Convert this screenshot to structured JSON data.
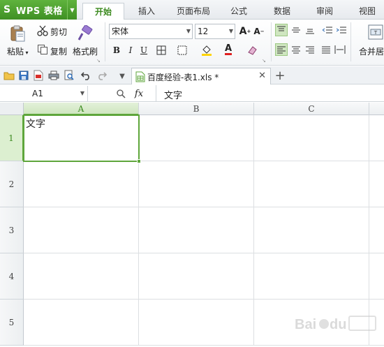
{
  "app": {
    "name": "WPS 表格"
  },
  "menu": {
    "tabs": [
      "开始",
      "插入",
      "页面布局",
      "公式",
      "数据",
      "审阅",
      "视图"
    ],
    "active": "开始"
  },
  "ribbon": {
    "paste": "粘贴",
    "cut": "剪切",
    "copy": "复制",
    "format_painter": "格式刷",
    "font_name": "宋体",
    "font_size": "12",
    "merge_center": "合并居"
  },
  "document": {
    "tab_title": "百度经验-表1.xls *"
  },
  "formula_bar": {
    "name_box": "A1",
    "fx": "fx",
    "content": "文字"
  },
  "sheet": {
    "columns": [
      "A",
      "B",
      "C"
    ],
    "rows": [
      "1",
      "2",
      "3",
      "4",
      "5"
    ],
    "selected_cell": "A1",
    "cells": {
      "A1": "文字"
    }
  },
  "colors": {
    "accent": "#5ea63b",
    "brand": "#4a9d2a"
  }
}
